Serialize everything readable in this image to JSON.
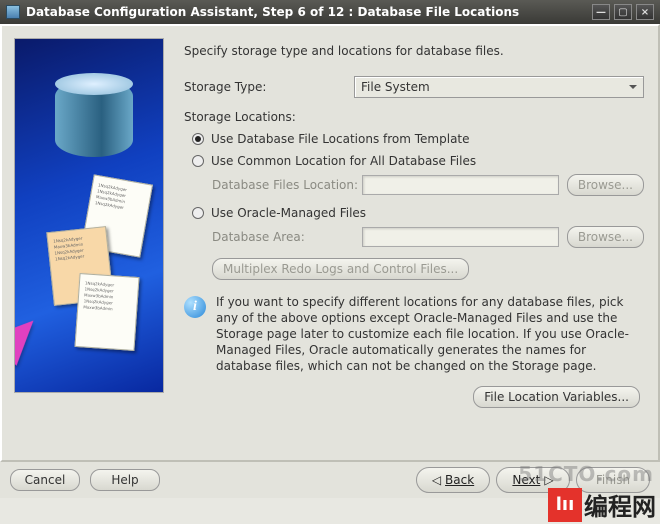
{
  "window": {
    "title": "Database Configuration Assistant, Step 6 of 12 : Database File Locations"
  },
  "intro": "Specify storage type and locations for database files.",
  "storage_type": {
    "label": "Storage Type:",
    "value": "File System"
  },
  "locations_header": "Storage Locations:",
  "radios": {
    "template": {
      "label": "Use Database File Locations from Template",
      "selected": true
    },
    "common": {
      "label": "Use Common Location for All Database Files",
      "selected": false
    },
    "omf": {
      "label": "Use Oracle-Managed Files",
      "selected": false
    }
  },
  "db_files_location": {
    "label": "Database Files Location:",
    "value": "",
    "browse": "Browse..."
  },
  "db_area": {
    "label": "Database Area:",
    "value": "",
    "browse": "Browse..."
  },
  "multiplex_button": "Multiplex Redo Logs and Control Files...",
  "info_text": "If you want to specify different locations for any database files, pick any of the above options except Oracle-Managed Files and use the Storage page later to customize each file location. If you use Oracle-Managed Files, Oracle automatically generates the names for database files, which can not be changed on the Storage page.",
  "file_loc_vars_button": "File Location Variables...",
  "buttons": {
    "cancel": "Cancel",
    "help": "Help",
    "back": "Back",
    "next": "Next",
    "finish": "Finish"
  },
  "watermarks": {
    "a": "51CTO.com",
    "b_badge": "lıı",
    "b_text": "编程网"
  }
}
